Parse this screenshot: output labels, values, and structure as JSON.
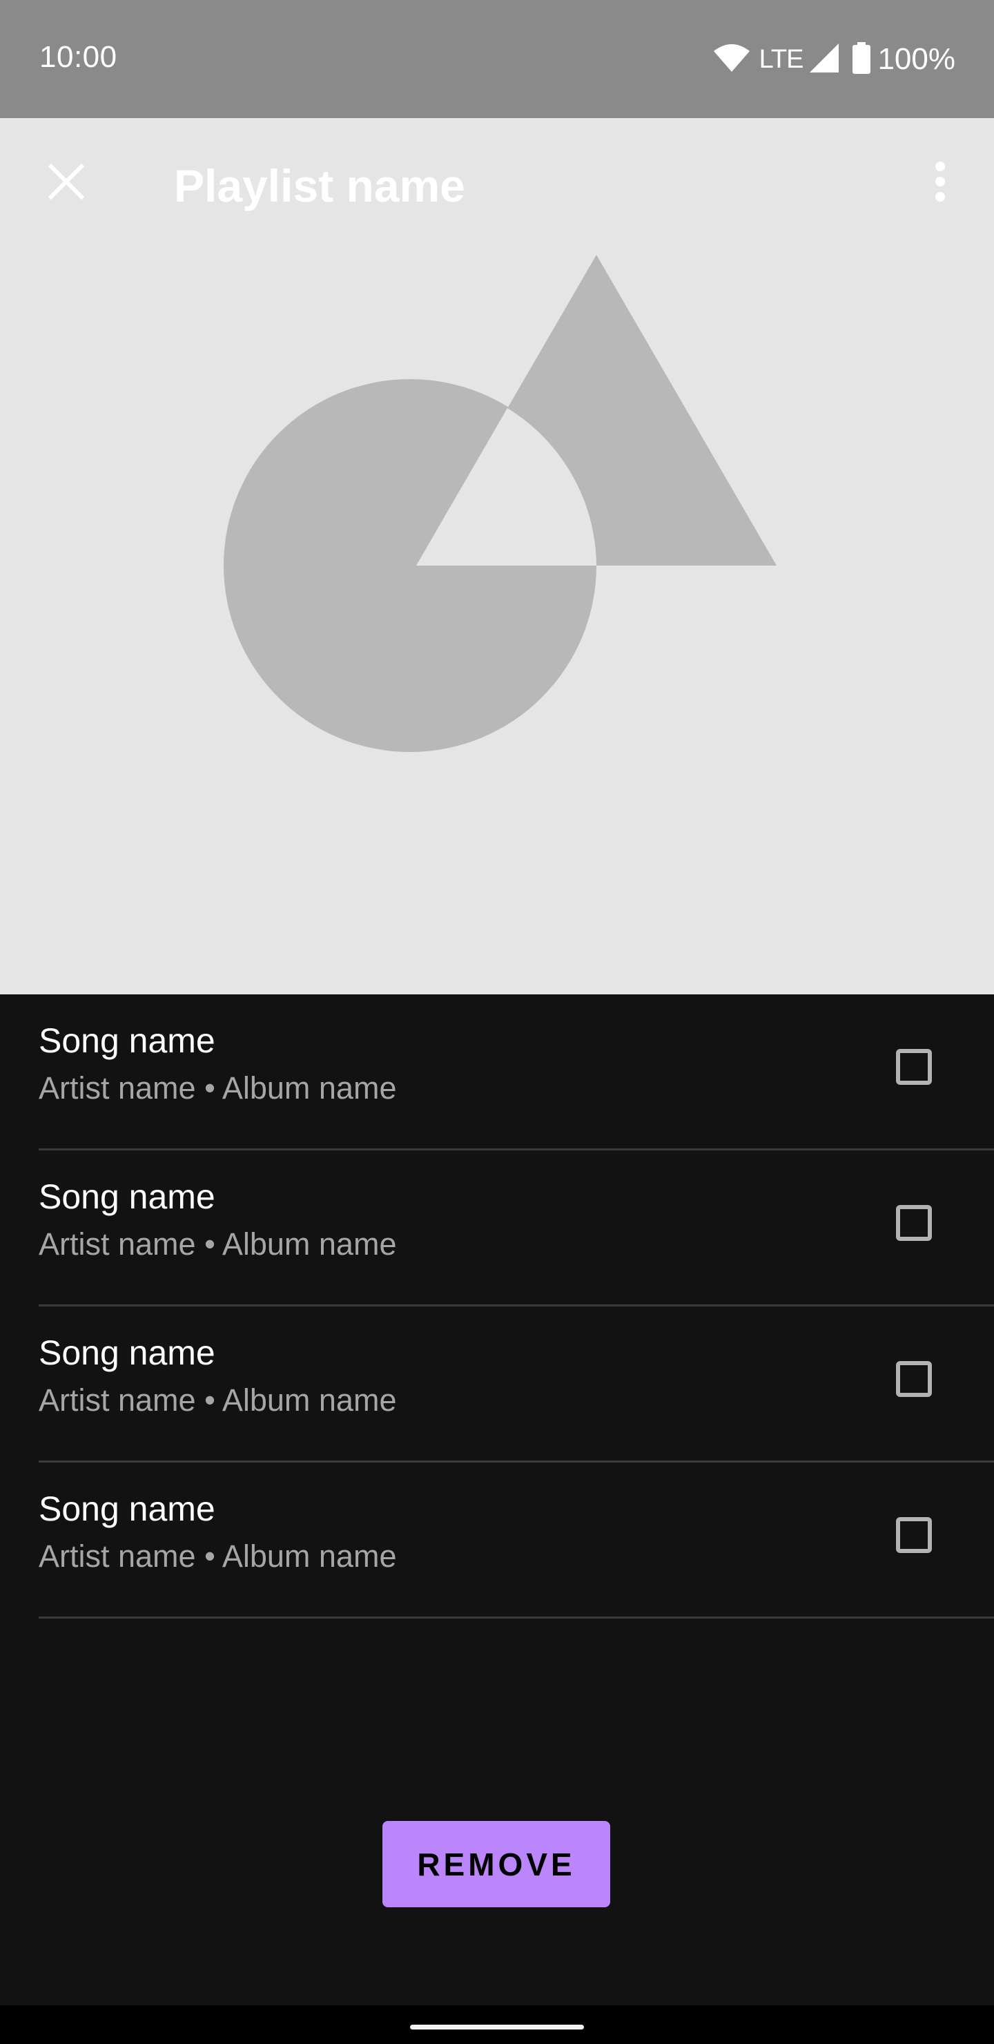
{
  "status_bar": {
    "time": "10:00",
    "network": "LTE",
    "battery": "100%"
  },
  "header": {
    "title": "Playlist name",
    "close_icon": "close-icon",
    "menu_icon": "more-vert-icon",
    "background": "#e5e5e5",
    "artwork_color": "#b8b8b8"
  },
  "songs": [
    {
      "title": "Song name",
      "subtitle": "Artist name • Album name",
      "checked": false
    },
    {
      "title": "Song name",
      "subtitle": "Artist name • Album name",
      "checked": false
    },
    {
      "title": "Song name",
      "subtitle": "Artist name • Album name",
      "checked": false
    },
    {
      "title": "Song name",
      "subtitle": "Artist name • Album name",
      "checked": false
    }
  ],
  "actions": {
    "remove_label": "REMOVE",
    "accent": "#bb86fc"
  }
}
